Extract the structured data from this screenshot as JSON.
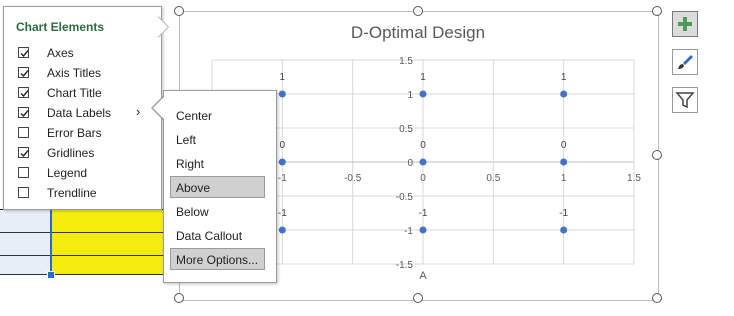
{
  "chart": {
    "title": "D-Optimal Design",
    "x_axis_title": "A"
  },
  "chart_elements_menu": {
    "title": "Chart Elements",
    "items": [
      {
        "label": "Axes",
        "checked": true,
        "has_submenu": false
      },
      {
        "label": "Axis Titles",
        "checked": true,
        "has_submenu": false
      },
      {
        "label": "Chart Title",
        "checked": true,
        "has_submenu": false
      },
      {
        "label": "Data Labels",
        "checked": true,
        "has_submenu": true
      },
      {
        "label": "Error Bars",
        "checked": false,
        "has_submenu": false
      },
      {
        "label": "Gridlines",
        "checked": true,
        "has_submenu": false
      },
      {
        "label": "Legend",
        "checked": false,
        "has_submenu": false
      },
      {
        "label": "Trendline",
        "checked": false,
        "has_submenu": false
      }
    ],
    "submenu_chevron": "›"
  },
  "data_labels_submenu": {
    "items": [
      "Center",
      "Left",
      "Right",
      "Above",
      "Below",
      "Data Callout",
      "More Options..."
    ],
    "selected": "Above",
    "hovered": "More Options..."
  },
  "side_buttons": [
    {
      "name": "chart-elements-button",
      "icon": "plus-icon",
      "active": true
    },
    {
      "name": "chart-styles-button",
      "icon": "paintbrush-icon",
      "active": false
    },
    {
      "name": "chart-filters-button",
      "icon": "funnel-icon",
      "active": false
    }
  ],
  "colors": {
    "point": "#4472c4",
    "grid": "#d9d9d9",
    "axis_text": "#595959",
    "accent_green": "#2e6b3f",
    "highlight_yellow": "#f5ec0f"
  },
  "chart_data": {
    "type": "scatter",
    "title": "D-Optimal Design",
    "xlabel": "A",
    "ylabel": "",
    "xlim": [
      -1.5,
      1.5
    ],
    "ylim": [
      -1.5,
      1.5
    ],
    "x_ticks": [
      "-1",
      "-0.5",
      "0",
      "0.5",
      "1",
      "1.5"
    ],
    "y_ticks": [
      "1.5",
      "1",
      "0.5",
      "0",
      "-0.5",
      "-1",
      "-1.5"
    ],
    "grid": true,
    "legend": false,
    "points": [
      {
        "x": -1,
        "y": 1,
        "label": "1"
      },
      {
        "x": 0,
        "y": 1,
        "label": "1"
      },
      {
        "x": 1,
        "y": 1,
        "label": "1"
      },
      {
        "x": -1,
        "y": 0,
        "label": "0"
      },
      {
        "x": 0,
        "y": 0,
        "label": "0"
      },
      {
        "x": 1,
        "y": 0,
        "label": "0"
      },
      {
        "x": -1,
        "y": -1,
        "label": "-1"
      },
      {
        "x": 0,
        "y": -1,
        "label": "-1"
      },
      {
        "x": 1,
        "y": -1,
        "label": "-1"
      }
    ]
  }
}
